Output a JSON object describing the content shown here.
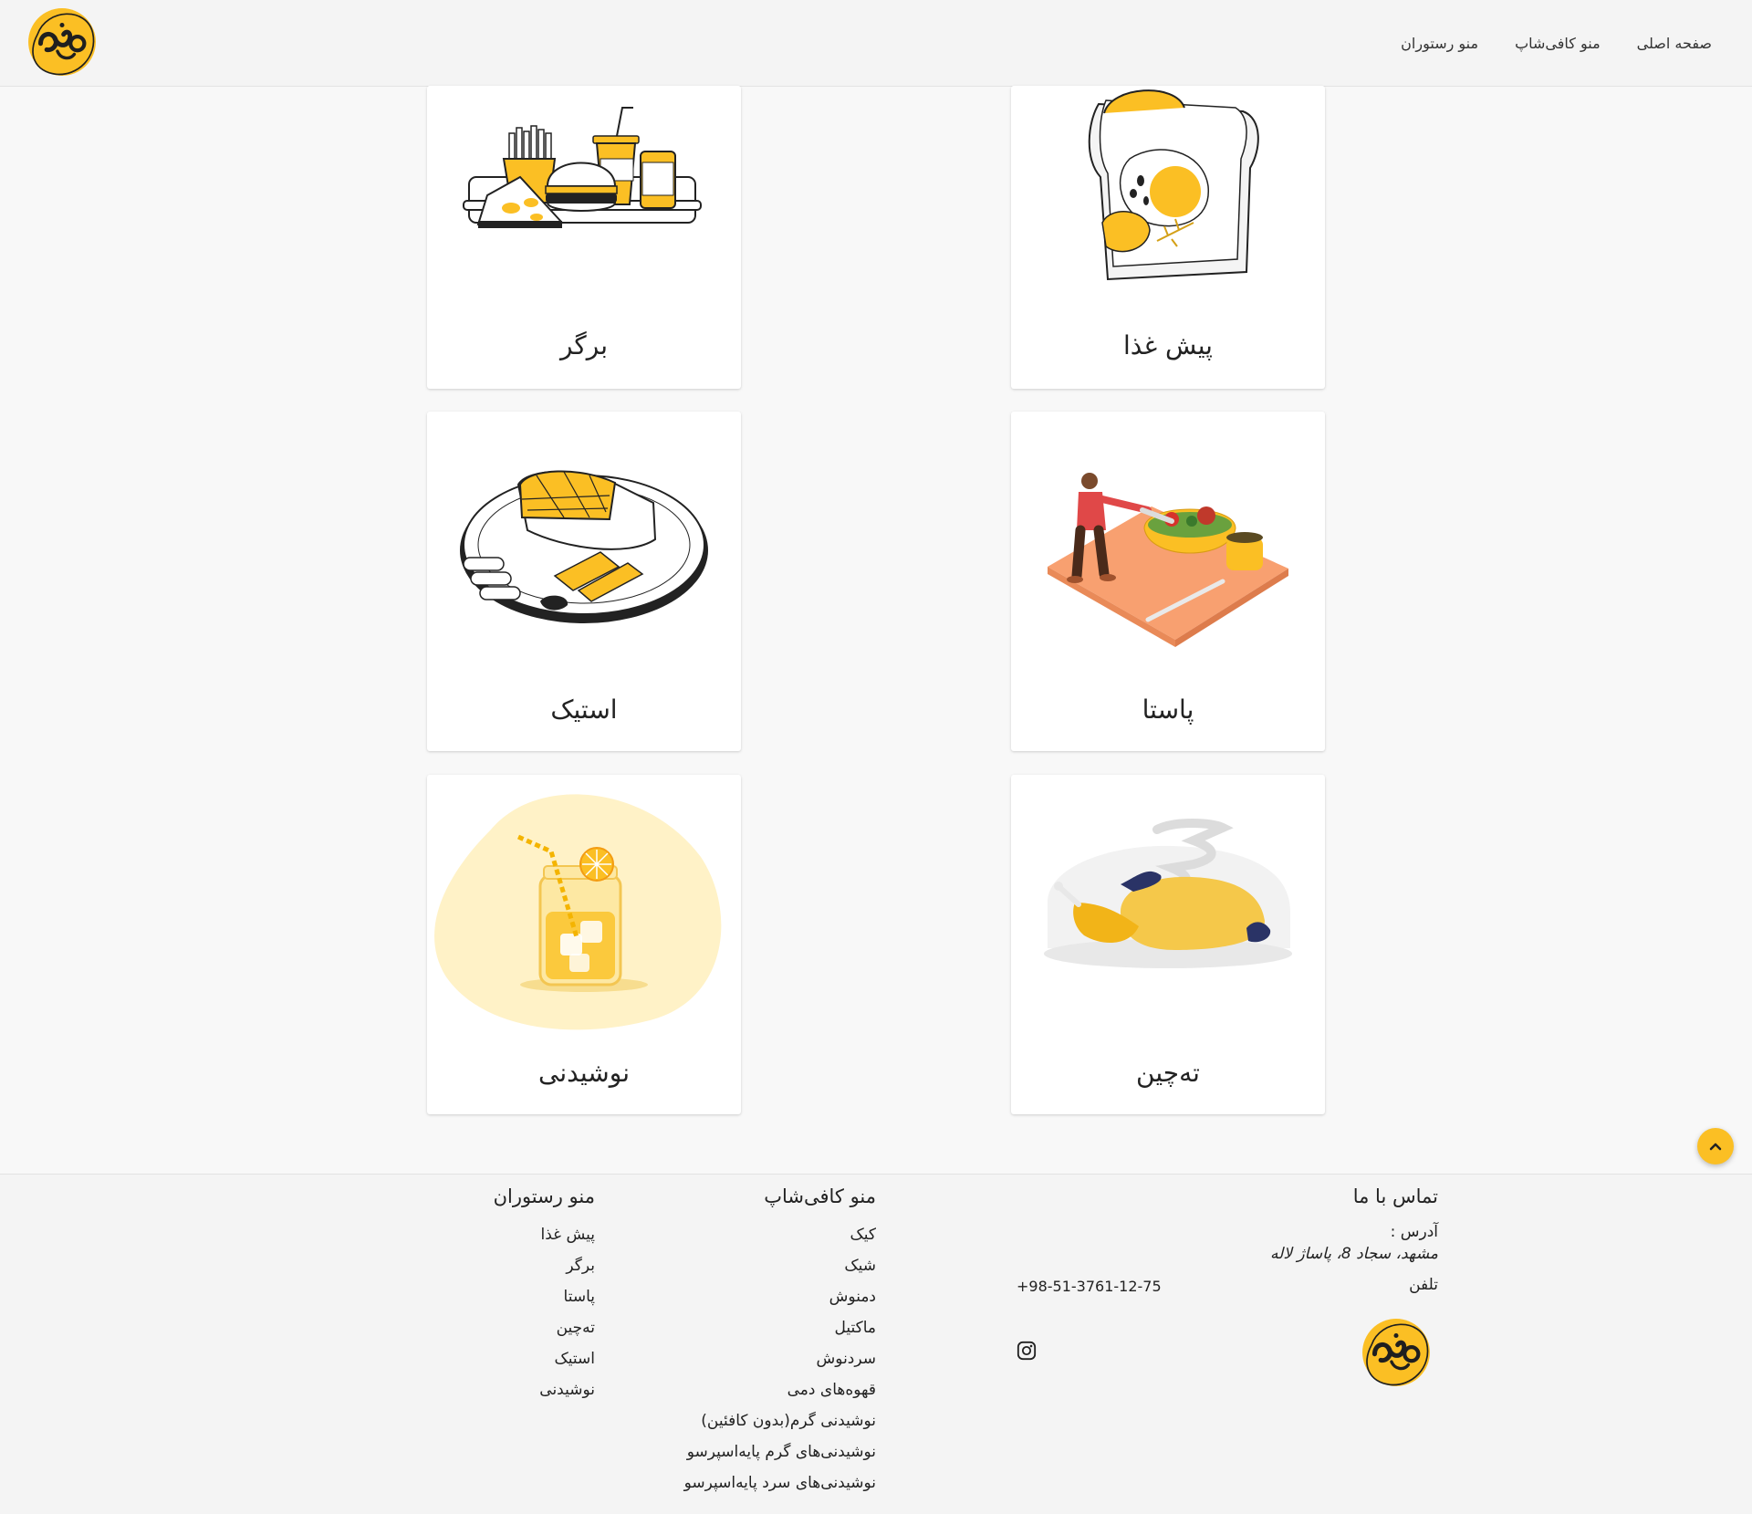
{
  "brand": {
    "name": "Wen cafe logo",
    "accent": "#fbbf24",
    "dark": "#1f1f1f"
  },
  "header": {
    "nav": [
      {
        "label": "صفحه اصلی"
      },
      {
        "label": "منو کافی‌شاپ"
      },
      {
        "label": "منو رستوران"
      }
    ]
  },
  "categories": [
    {
      "title": "برگر",
      "icon": "burger-combo-illustration"
    },
    {
      "title": "پیش غذا",
      "icon": "toast-egg-illustration"
    },
    {
      "title": "استیک",
      "icon": "steak-plate-illustration"
    },
    {
      "title": "پاستا",
      "icon": "chef-salad-illustration"
    },
    {
      "title": "نوشیدنی",
      "icon": "lemonade-jar-illustration"
    },
    {
      "title": "ته‌چین",
      "icon": "roast-chicken-illustration"
    }
  ],
  "back_to_top": {
    "icon": "chevron-up-icon"
  },
  "footer": {
    "restaurant_menu": {
      "heading": "منو رستوران",
      "items": [
        "پیش غذا",
        "برگر",
        "پاستا",
        "ته‌چین",
        "استیک",
        "نوشیدنی"
      ]
    },
    "cafe_menu": {
      "heading": "منو کافی‌شاپ",
      "items": [
        "کیک",
        "شیک",
        "دمنوش",
        "ماکتیل",
        "سردنوش",
        "قهوه‌های دمی",
        "نوشیدنی گرم(بدون کافئین)",
        "نوشیدنی‌های گرم پایه‌اسپرسو",
        "نوشیدنی‌های سرد پایه‌اسپرسو"
      ]
    },
    "contact": {
      "heading": "تماس با ما",
      "address_label": "آدرس :",
      "address": "مشهد، سجاد 8، پاساژ لاله",
      "phone_label": "تلفن",
      "phone": "+98-51-3761-12-75",
      "social_icon": "instagram-icon"
    }
  }
}
